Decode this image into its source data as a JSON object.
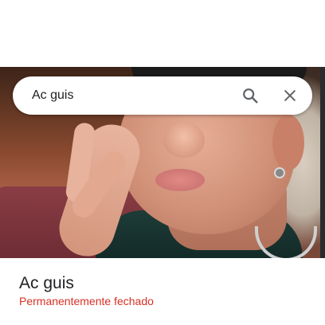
{
  "search": {
    "query": "Ac guis",
    "search_icon": "search-icon",
    "close_icon": "close-icon"
  },
  "place": {
    "name": "Ac guis",
    "status": "Permanentemente fechado"
  },
  "colors": {
    "status_closed": "#d93025",
    "text_primary": "#202124",
    "icon_gray": "#5f6368"
  }
}
